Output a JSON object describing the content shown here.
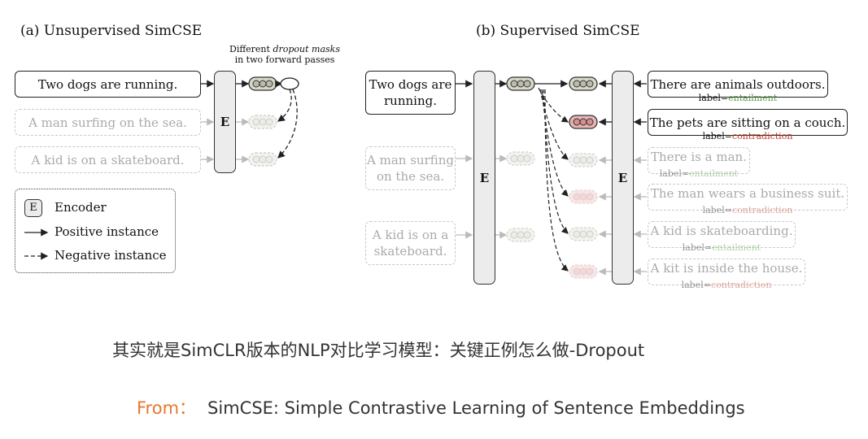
{
  "panel_a": {
    "title": "(a) Unsupervised SimCSE",
    "note_line1": "Different ",
    "note_italic": "dropout masks",
    "note_line2": "in two forward passes",
    "inputs": [
      "Two dogs are running.",
      "A man surfing on the sea.",
      "A kid is on a skateboard."
    ],
    "encoder": "E"
  },
  "panel_b": {
    "title": "(b) Supervised SimCSE",
    "inputs": [
      "Two dogs are running.",
      "A man surfing on the sea.",
      "A kid is on a skateboard."
    ],
    "encoder_left": "E",
    "encoder_right": "E",
    "outputs": [
      {
        "text": "There are animals outdoors.",
        "label_prefix": "label=",
        "label": "entailment"
      },
      {
        "text": "The pets are sitting on a couch.",
        "label_prefix": "label=",
        "label": "contradiction"
      },
      {
        "text": "There is a man.",
        "label_prefix": "label=",
        "label": "entailment"
      },
      {
        "text": "The man wears a business suit.",
        "label_prefix": "label=",
        "label": "contradiction"
      },
      {
        "text": "A kid is skateboarding.",
        "label_prefix": "label=",
        "label": "entailment"
      },
      {
        "text": "A kit is inside the house.",
        "label_prefix": "label=",
        "label": "contradiction"
      }
    ]
  },
  "legend": {
    "encoder_key": "E",
    "encoder": "Encoder",
    "positive": "Positive instance",
    "negative": "Negative instance"
  },
  "caption": {
    "line1": "其实就是SimCLR版本的NLP对比学习模型：关键正例怎么做-Dropout",
    "from_label": "From：",
    "source": "SimCSE: Simple Contrastive Learning of Sentence Embeddings"
  },
  "colors": {
    "entailment": "#5b9a4a",
    "contradiction": "#c0392b",
    "from_label": "#e8772e",
    "pos_embed": "#d8d8c8",
    "neg_embed": "#e8b4b4"
  }
}
